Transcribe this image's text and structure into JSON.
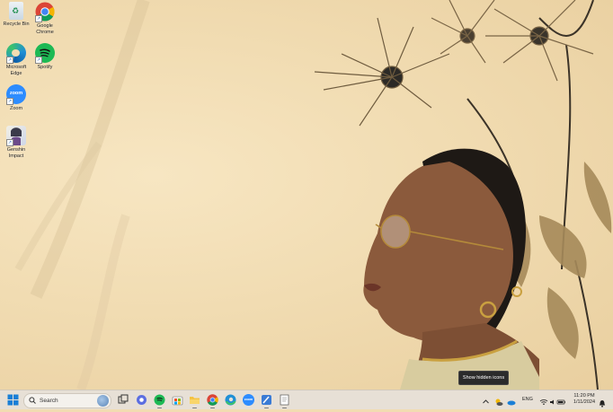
{
  "desktop": {
    "icons": [
      {
        "label": "Recycle Bin",
        "icon": "recycle-bin-icon"
      },
      {
        "label": "Google Chrome",
        "icon": "chrome-icon"
      },
      {
        "label": "Microsoft Edge",
        "icon": "edge-icon"
      },
      {
        "label": "Spotify",
        "icon": "spotify-icon"
      },
      {
        "label": "Zoom",
        "icon": "zoom-icon",
        "glyph_text": "zoom"
      },
      {
        "label": "Genshin Impact",
        "icon": "genshin-impact-icon"
      }
    ]
  },
  "tooltip": {
    "text": "Show hidden icons"
  },
  "taskbar": {
    "search_placeholder": "Search",
    "apps": [
      "windows-start-icon",
      "task-view-icon",
      "chat-icon",
      "spotify-icon",
      "store-icon",
      "file-explorer-icon",
      "chrome-icon",
      "edge-icon",
      "zoom-icon",
      "pen-tool-icon",
      "notepad-icon"
    ],
    "zoom_glyph": "zoom",
    "tray": {
      "language": "ENG",
      "time": "11:20 PM",
      "date": "1/11/2024"
    }
  },
  "colors": {
    "wallpaper": "#f1dcb2",
    "taskbar": "#e7e0d6",
    "chrome_red": "#db4437",
    "chrome_yellow": "#f4b400",
    "chrome_green": "#0f9d58",
    "chrome_blue": "#4285f4",
    "spotify": "#1db954",
    "zoom": "#2d8cff",
    "edge": "#1f8fd6"
  }
}
